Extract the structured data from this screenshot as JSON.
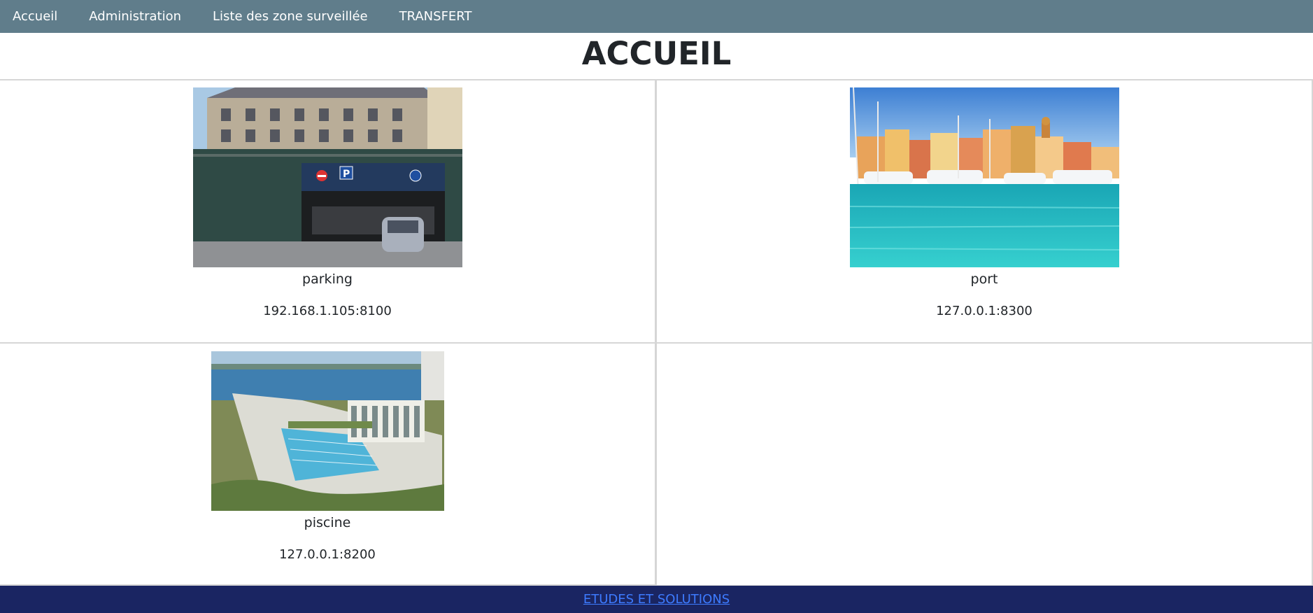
{
  "nav": {
    "items": [
      {
        "label": "Accueil"
      },
      {
        "label": "Administration"
      },
      {
        "label": "Liste des zone surveillée"
      },
      {
        "label": "TRANSFERT"
      }
    ]
  },
  "page_title": "ACCUEIL",
  "zones": [
    {
      "name": "parking",
      "address": "192.168.1.105:8100"
    },
    {
      "name": "port",
      "address": "127.0.0.1:8300"
    },
    {
      "name": "piscine",
      "address": "127.0.0.1:8200"
    }
  ],
  "footer": {
    "link_label": "ETUDES ET SOLUTIONS"
  },
  "colors": {
    "navbar": "#607d8b",
    "footer": "#1a2562",
    "footer_link": "#3d7bff"
  }
}
